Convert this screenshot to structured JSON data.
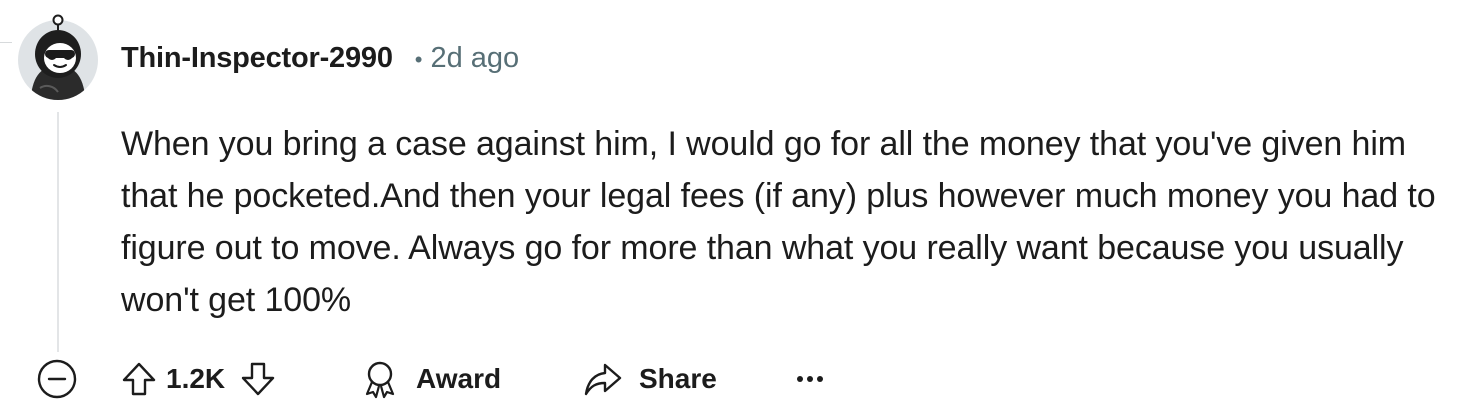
{
  "comment": {
    "author": "Thin-Inspector-2990",
    "separator": "•",
    "timestamp": "2d ago",
    "body": "When you bring a case against him, I would go for all the money that you've given him that he pocketed.And then your legal fees (if any) plus however much money you had to figure out to move. Always go for more than what you really want because you usually won't get 100%"
  },
  "actions": {
    "score": "1.2K",
    "award_label": "Award",
    "share_label": "Share",
    "more_label": "More options"
  },
  "icons": {
    "collapse": "collapse-minus-icon",
    "upvote": "arrow-up-icon",
    "downvote": "arrow-down-icon",
    "award": "award-ribbon-icon",
    "share": "share-arrow-icon",
    "more": "ellipsis-icon"
  },
  "colors": {
    "text": "#1c1c1c",
    "meta": "#576f76",
    "thread_line": "#e3e5e7"
  }
}
